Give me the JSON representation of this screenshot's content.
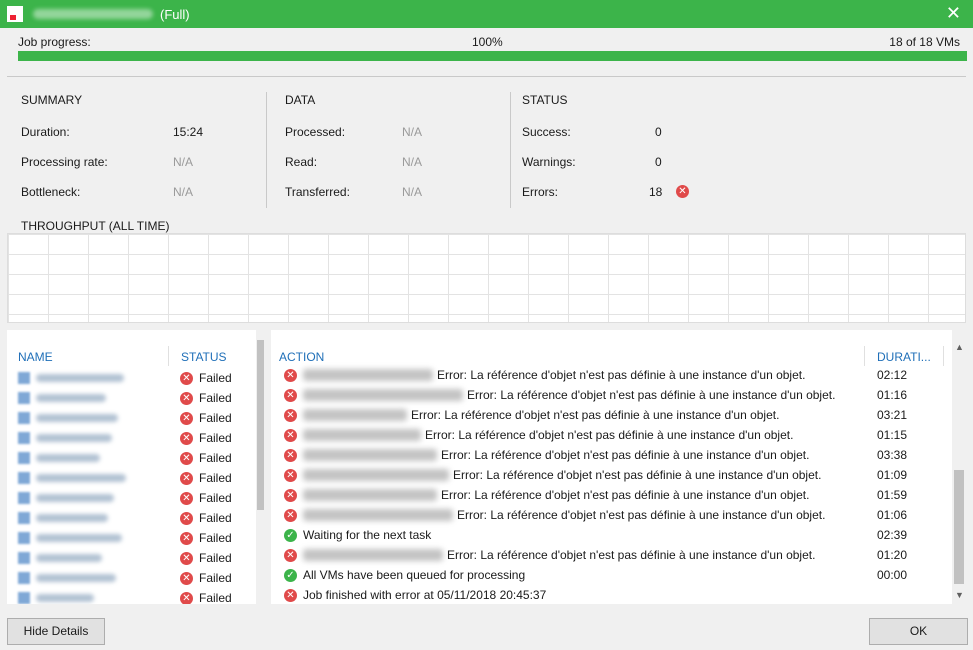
{
  "title": {
    "mode": "(Full)"
  },
  "progress": {
    "label": "Job progress:",
    "percent_text": "100%",
    "percent": 100,
    "count_text": "18 of 18 VMs"
  },
  "summary": {
    "heading": "SUMMARY",
    "duration_label": "Duration:",
    "duration": "15:24",
    "rate_label": "Processing rate:",
    "rate": "N/A",
    "bottleneck_label": "Bottleneck:",
    "bottleneck": "N/A"
  },
  "data_section": {
    "heading": "DATA",
    "processed_label": "Processed:",
    "processed": "N/A",
    "read_label": "Read:",
    "read": "N/A",
    "transferred_label": "Transferred:",
    "transferred": "N/A"
  },
  "status_section": {
    "heading": "STATUS",
    "success_label": "Success:",
    "success": "0",
    "warnings_label": "Warnings:",
    "warnings": "0",
    "errors_label": "Errors:",
    "errors": "18"
  },
  "throughput": {
    "heading": "THROUGHPUT (ALL TIME)"
  },
  "vm_table": {
    "col_name": "NAME",
    "col_status": "STATUS",
    "rows": [
      {
        "status": "Failed"
      },
      {
        "status": "Failed"
      },
      {
        "status": "Failed"
      },
      {
        "status": "Failed"
      },
      {
        "status": "Failed"
      },
      {
        "status": "Failed"
      },
      {
        "status": "Failed"
      },
      {
        "status": "Failed"
      },
      {
        "status": "Failed"
      },
      {
        "status": "Failed"
      },
      {
        "status": "Failed"
      },
      {
        "status": "Failed"
      }
    ]
  },
  "action_table": {
    "col_action": "ACTION",
    "col_duration": "DURATI...",
    "rows": [
      {
        "type": "error",
        "text": "Error: La référence d'objet n'est pas définie à une instance d'un objet.",
        "duration": "02:12"
      },
      {
        "type": "error",
        "text": "Error: La référence d'objet n'est pas définie à une instance d'un objet.",
        "duration": "01:16"
      },
      {
        "type": "error",
        "text": "Error: La référence d'objet n'est pas définie à une instance d'un objet.",
        "duration": "03:21"
      },
      {
        "type": "error",
        "text": "Error: La référence d'objet n'est pas définie à une instance d'un objet.",
        "duration": "01:15"
      },
      {
        "type": "error",
        "text": "Error: La référence d'objet n'est pas définie à une instance d'un objet.",
        "duration": "03:38"
      },
      {
        "type": "error",
        "text": "Error: La référence d'objet n'est pas définie à une instance d'un objet.",
        "duration": "01:09"
      },
      {
        "type": "error",
        "text": "Error: La référence d'objet n'est pas définie à une instance d'un objet.",
        "duration": "01:59"
      },
      {
        "type": "error",
        "text": "Error: La référence d'objet n'est pas définie à une instance d'un objet.",
        "duration": "01:06"
      },
      {
        "type": "success",
        "text": "Waiting for the next task",
        "duration": "02:39"
      },
      {
        "type": "error",
        "text": "Error: La référence d'objet n'est pas définie à une instance d'un objet.",
        "duration": "01:20"
      },
      {
        "type": "success",
        "text": "All VMs have been queued for processing",
        "duration": "00:00"
      },
      {
        "type": "error",
        "text": "Job finished with error at 05/11/2018 20:45:37",
        "duration": ""
      }
    ]
  },
  "buttons": {
    "hide_details": "Hide Details",
    "ok": "OK"
  },
  "colors": {
    "accent": "#3cb44a",
    "error": "#e04a4a",
    "header_link": "#1f6fb8"
  }
}
